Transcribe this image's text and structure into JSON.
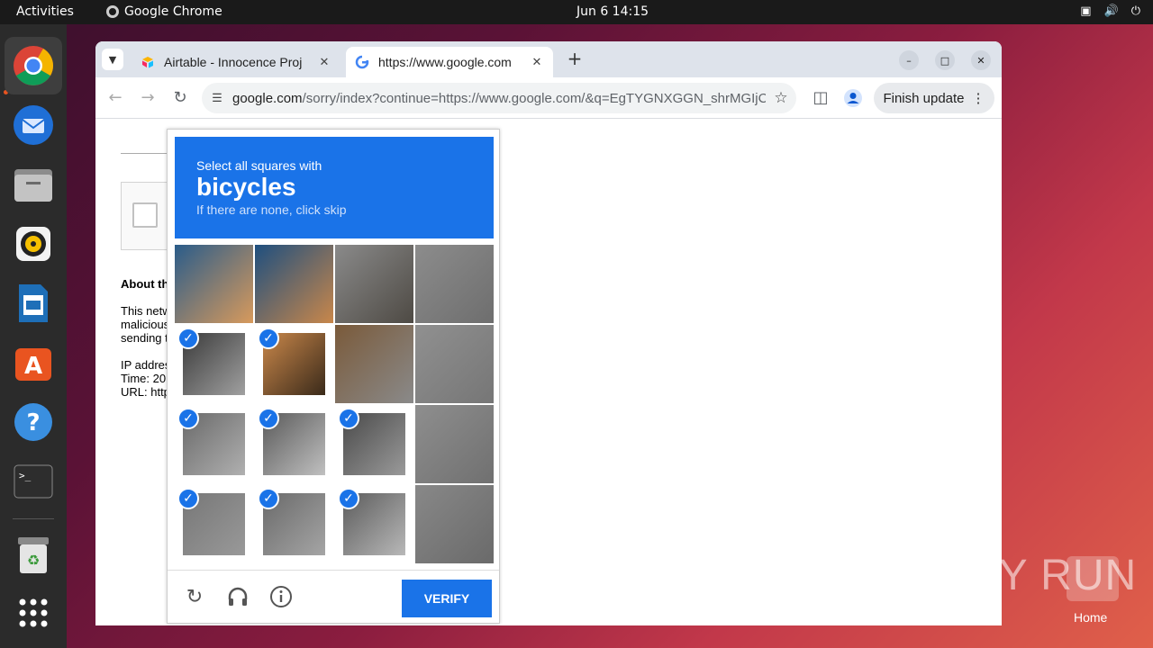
{
  "topbar": {
    "activities": "Activities",
    "app_name": "Google Chrome",
    "clock": "Jun 6  14:15"
  },
  "dock": {
    "items": [
      "chrome-icon",
      "thunderbird-icon",
      "files-icon",
      "rhythmbox-icon",
      "writer-icon",
      "app-center-icon",
      "help-icon",
      "terminal-icon",
      "trash-icon",
      "apps-grid-icon"
    ]
  },
  "browser": {
    "tabs": [
      {
        "title": "Airtable - Innocence Proj"
      },
      {
        "title": "https://www.google.com"
      }
    ],
    "address": {
      "host": "google.com",
      "path": "/sorry/index?continue=https://www.google.com/&q=EgTYGNXGGN_shrMGIjCZl..."
    },
    "finish_update": "Finish update"
  },
  "page": {
    "about": "About th",
    "para1": [
      "This netw",
      "malicious",
      "sending t"
    ],
    "para2": [
      "IP addres",
      "Time: 20",
      "URL: http"
    ]
  },
  "captcha": {
    "instruction": "Select all squares with",
    "target": "bicycles",
    "hint": "If there are none, click skip",
    "verify_label": "VERIFY",
    "selected": [
      false,
      false,
      false,
      false,
      true,
      true,
      false,
      false,
      true,
      true,
      true,
      false,
      true,
      true,
      true,
      false
    ]
  },
  "watermark": {
    "text": "ANY RUN",
    "home_label": "Home"
  }
}
